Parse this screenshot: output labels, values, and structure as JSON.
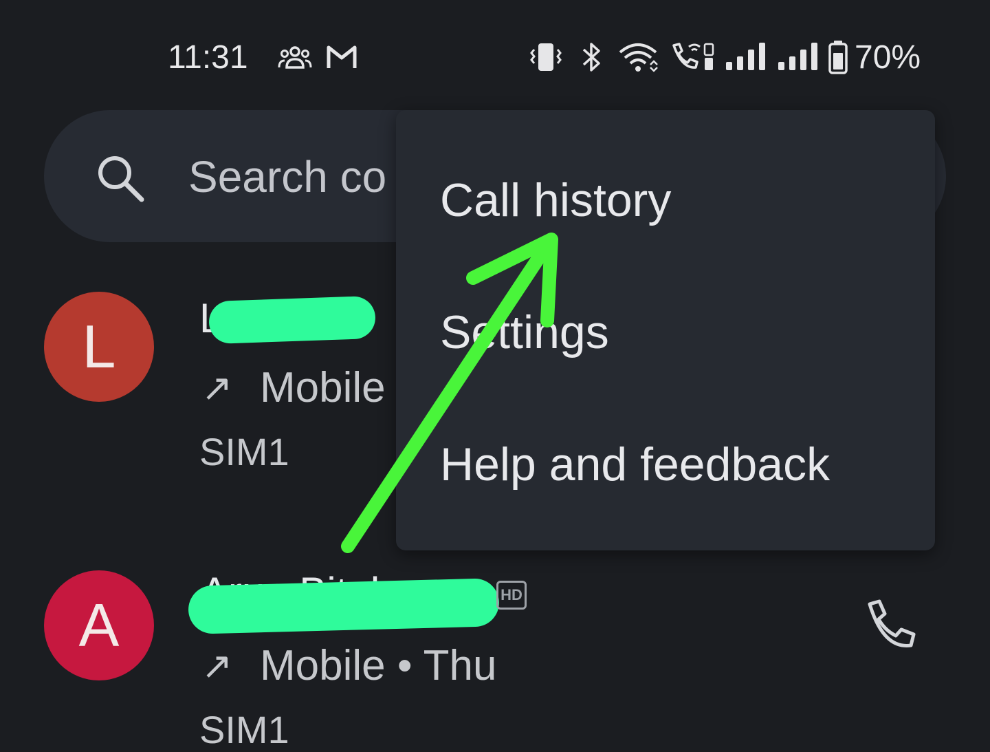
{
  "status_bar": {
    "time": "11:31",
    "battery_percent": "70%",
    "icons": [
      "group-icon",
      "gmail-icon",
      "vibrate-icon",
      "bluetooth-icon",
      "wifi-icon",
      "wifi-calling-icon",
      "signal-sim1-icon",
      "signal-sim2-icon",
      "battery-icon"
    ]
  },
  "search": {
    "placeholder": "Search co"
  },
  "contacts": [
    {
      "initial": "L",
      "name": "L",
      "call_direction": "↗",
      "meta": "Mobile",
      "sim": "SIM1",
      "avatar_color": "#b53a2f"
    },
    {
      "initial": "A",
      "name": "Arun Bituh",
      "call_direction": "↗",
      "meta": "Mobile • Thu",
      "sim": "SIM1",
      "hd": "HD",
      "avatar_color": "#c6183f"
    }
  ],
  "menu": {
    "items": [
      "Call history",
      "Settings",
      "Help and feedback"
    ]
  },
  "colors": {
    "background": "#1b1d21",
    "surface": "#262a31",
    "annotation_arrow": "#49f53a",
    "redaction": "#2ffb9b"
  }
}
